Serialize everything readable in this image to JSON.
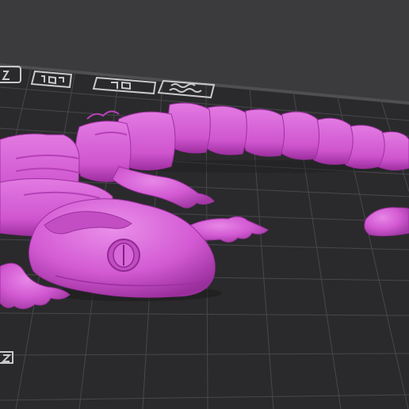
{
  "viewport": {
    "background": "#3b3b3d",
    "plate_color": "#2a2a2c",
    "grid_color": "#4a4a4d",
    "model_color": "#d35ad3",
    "model_highlight": "#e27ae2",
    "model_shadow": "#9e2fa0",
    "model_name": "",
    "plate_icons": [
      "printer-logo-icon",
      "bed-label-icon",
      "brand-badge-icon",
      "wave-logo-icon"
    ]
  }
}
